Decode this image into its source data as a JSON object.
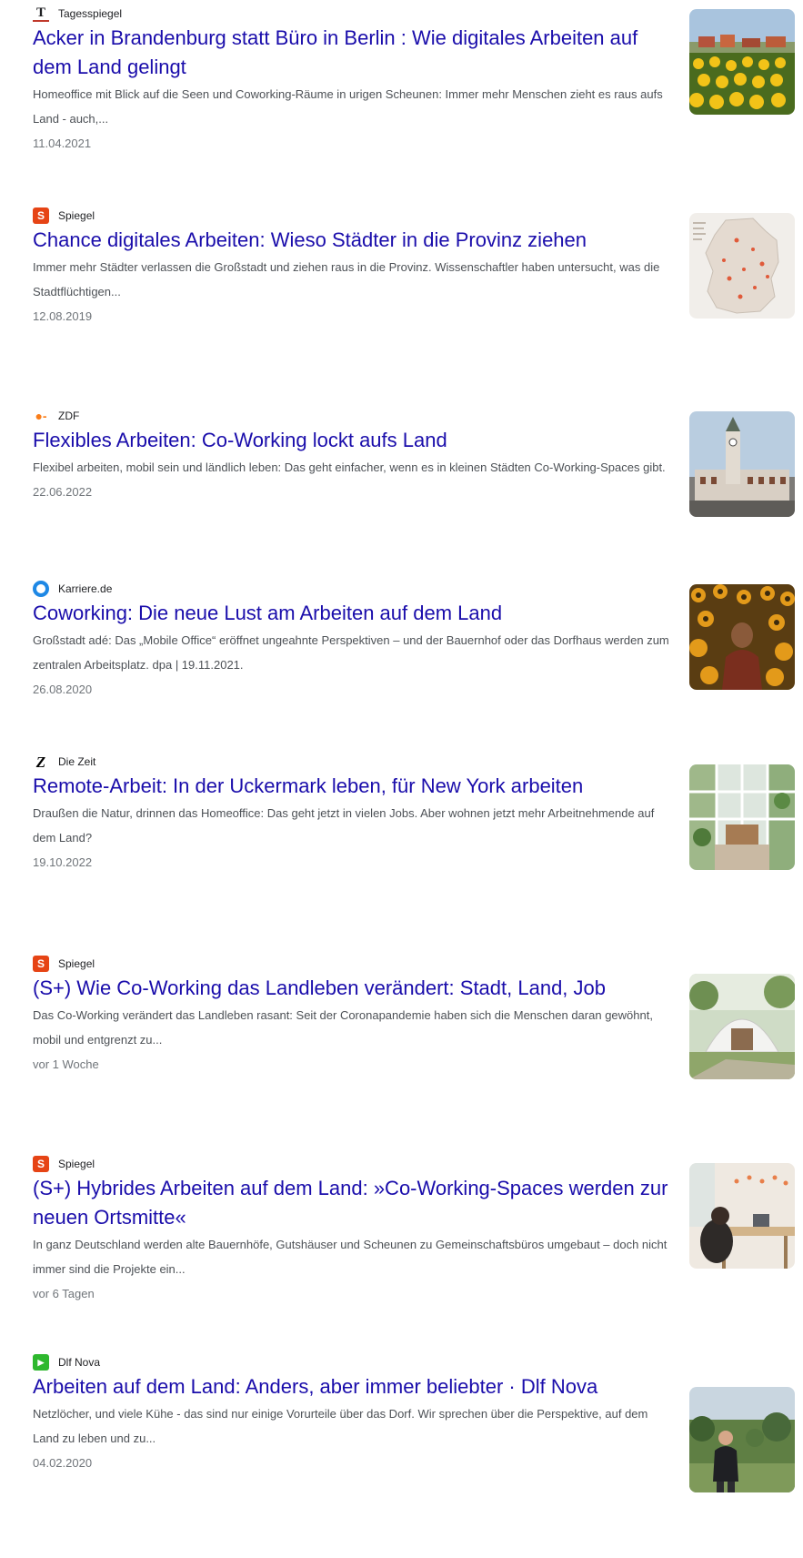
{
  "results": [
    {
      "source": "Tagesspiegel",
      "icon": "tagesspiegel-logo-icon",
      "icon_glyph": "T",
      "title": "Acker in Brandenburg statt Büro in Berlin : Wie digitales Arbeiten auf dem Land gelingt",
      "snippet": "Homeoffice mit Blick auf die Seen und Coworking-Räume in urigen Scheunen: Immer mehr Menschen zieht es raus aufs Land - auch,...",
      "date": "11.04.2021",
      "thumbnail": "sunflower-field-village-image"
    },
    {
      "source": "Spiegel",
      "icon": "spiegel-logo-icon",
      "icon_glyph": "S",
      "title": "Chance digitales Arbeiten: Wieso Städter in die Provinz ziehen",
      "snippet": "Immer mehr Städter verlassen die Großstadt und ziehen raus in die Provinz. Wissenschaftler haben untersucht, was die Stadtflüchtigen...",
      "date": "12.08.2019",
      "thumbnail": "germany-map-image"
    },
    {
      "source": "ZDF",
      "icon": "zdf-logo-icon",
      "icon_glyph": "●-",
      "title": "Flexibles Arbeiten: Co-Working lockt aufs Land",
      "snippet": "Flexibel arbeiten, mobil sein und ländlich leben: Das geht einfacher, wenn es in kleinen Städten Co-Working-Spaces gibt.",
      "date": "22.06.2022",
      "thumbnail": "town-hall-tower-image"
    },
    {
      "source": "Karriere.de",
      "icon": "karriere-logo-icon",
      "icon_glyph": "",
      "title": "Coworking: Die neue Lust am Arbeiten auf dem Land",
      "snippet": "Großstadt adé: Das „Mobile Office“ eröffnet ungeahnte Perspektiven – und der Bauernhof oder das Dorfhaus werden zum zentralen Arbeitsplatz. dpa | 19.11.2021.",
      "date": "26.08.2020",
      "thumbnail": "woman-in-sunflowers-image"
    },
    {
      "source": "Die Zeit",
      "icon": "zeit-logo-icon",
      "icon_glyph": "Z",
      "title": "Remote-Arbeit: In der Uckermark leben, für New York arbeiten",
      "snippet": "Draußen die Natur, drinnen das Homeoffice: Das geht jetzt in vielen Jobs. Aber wohnen jetzt mehr Arbeitnehmende auf dem Land?",
      "date": "19.10.2022",
      "thumbnail": "greenhouse-office-image"
    },
    {
      "source": "Spiegel",
      "icon": "spiegel-logo-icon",
      "icon_glyph": "S",
      "title": "(S+) Wie Co-Working das Landleben verändert: Stadt, Land, Job",
      "snippet": "Das Co-Working verändert das Landleben rasant: Seit der Coronapandemie haben sich die Menschen daran gewöhnt, mobil und entgrenzt zu...",
      "date": "vor 1 Woche",
      "thumbnail": "dome-tent-image"
    },
    {
      "source": "Spiegel",
      "icon": "spiegel-logo-icon",
      "icon_glyph": "S",
      "title": "(S+) Hybrides Arbeiten auf dem Land: »Co-Working-Spaces werden zur neuen Ortsmitte«",
      "snippet": "In ganz Deutschland werden alte Bauernhöfe, Gutshäuser und Scheunen zu Gemeinschaftsbüros umgebaut – doch nicht immer sind die Projekte ein...",
      "date": "vor 6 Tagen",
      "thumbnail": "coworking-room-image"
    },
    {
      "source": "Dlf Nova",
      "icon": "dlf-nova-logo-icon",
      "icon_glyph": "▶",
      "title": "Arbeiten auf dem Land: Anders, aber immer beliebter · Dlf Nova",
      "snippet": "Netzlöcher, und viele Kühe - das sind nur einige Vorurteile über das Dorf. Wir sprechen über die Perspektive, auf dem Land zu leben und zu...",
      "date": "04.02.2020",
      "thumbnail": "man-in-countryside-image"
    }
  ],
  "colors": {
    "link": "#1a0dab",
    "snippet": "#4d5156",
    "date": "#70757a",
    "spiegel": "#e64415",
    "zdf": "#fa7d19",
    "karriere": "#1e88e5",
    "dlf_nova": "#2eb82e"
  }
}
